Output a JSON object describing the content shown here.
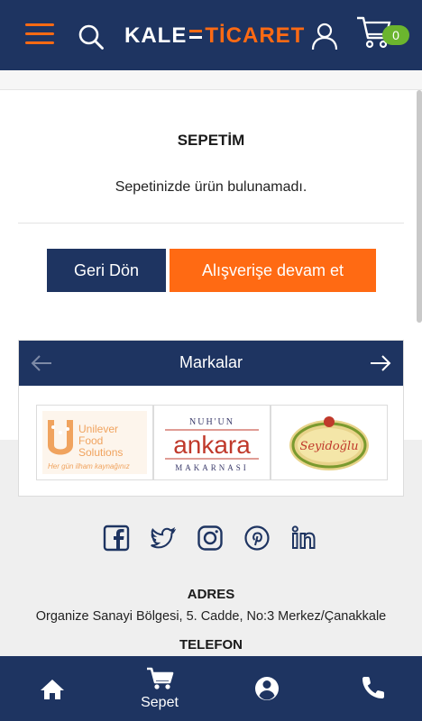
{
  "header": {
    "logo_left": "KALE",
    "logo_right": "TİCARET",
    "cart_count": "0"
  },
  "main": {
    "title": "SEPETİM",
    "empty_message": "Sepetinizde ürün bulunamadı.",
    "back_button": "Geri Dön",
    "continue_button": "Alışverişe devam et"
  },
  "brands": {
    "title": "Markalar",
    "items": [
      {
        "name": "Unilever Food Solutions",
        "line1": "Unilever",
        "line2": "Food",
        "line3": "Solutions",
        "tagline": "Her gün ilham kaynağınız"
      },
      {
        "name": "Nuh'un Ankara Makarnası",
        "top": "NUH'UN",
        "main": "ankara",
        "bottom": "MAKARNASI"
      },
      {
        "name": "Seyidoğlu",
        "main": "Seyidoğlu"
      }
    ]
  },
  "footer": {
    "address_title": "ADRES",
    "address": "Organize Sanayi Bölgesi, 5. Cadde, No:3 Merkez/Çanakkale",
    "phone_title": "TELEFON"
  },
  "bottom_nav": {
    "cart_label": "Sepet"
  },
  "colors": {
    "navy": "#1e3461",
    "orange": "#ff6a13",
    "green": "#6bb52e"
  }
}
